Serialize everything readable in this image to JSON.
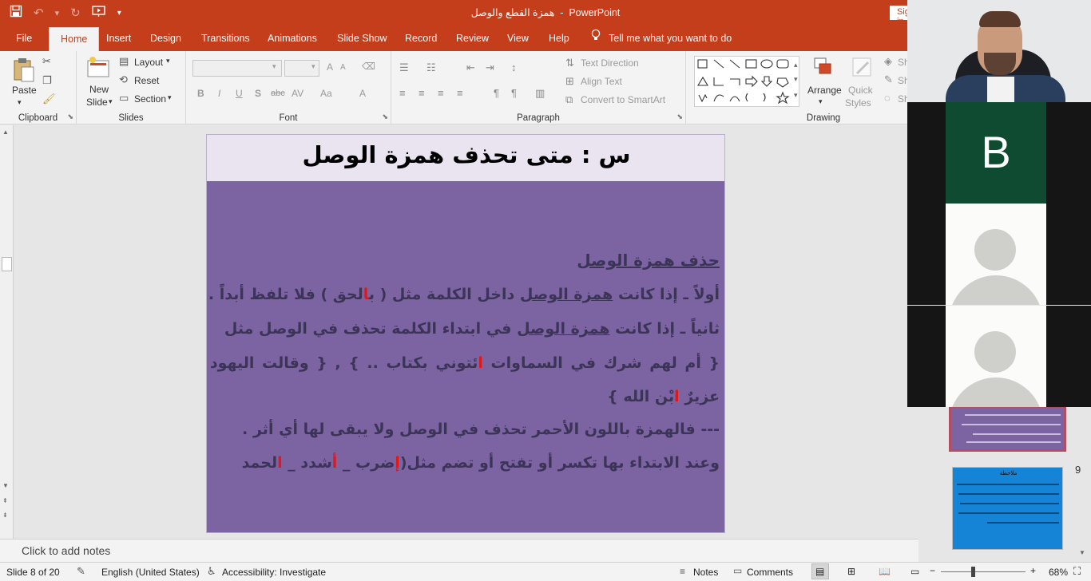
{
  "window": {
    "doc_title": "همزة القطع والوصل",
    "app_sep": "  -  ",
    "app_name": "PowerPoint",
    "signin": "Sign in"
  },
  "qat": {
    "save_icon": "save-icon",
    "undo_icon": "undo-icon",
    "redo_icon": "redo-icon",
    "present_icon": "start-from-beginning-icon",
    "more_icon": "customize-icon"
  },
  "tabs": [
    "File",
    "Home",
    "Insert",
    "Design",
    "Transitions",
    "Animations",
    "Slide Show",
    "Record",
    "Review",
    "View",
    "Help"
  ],
  "tell_me": "Tell me what you want to do",
  "ribbon": {
    "clipboard": {
      "label": "Clipboard",
      "paste": "Paste"
    },
    "slides": {
      "label": "Slides",
      "new_slide_1": "New",
      "new_slide_2": "Slide",
      "layout": "Layout",
      "reset": "Reset",
      "section": "Section"
    },
    "font": {
      "label": "Font",
      "bold": "B",
      "italic": "I",
      "underline": "U",
      "shadow": "S",
      "strike": "abc",
      "spacing": "AV",
      "case": "Aa",
      "color": "A"
    },
    "paragraph": {
      "label": "Paragraph",
      "text_direction": "Text Direction",
      "align_text": "Align Text",
      "smartart": "Convert to SmartArt"
    },
    "drawing": {
      "label": "Drawing",
      "arrange": "Arrange",
      "quick_styles_1": "Quick",
      "quick_styles_2": "Styles",
      "shape_fill": "Sh",
      "shape_outline": "Sh",
      "shape_effects": "Sh"
    }
  },
  "slide": {
    "title": "س : متى تحذف همزة الوصل",
    "heading": "حذف همزة الوصل",
    "l1_a": "أولاً ـ إذا كانت",
    "l1_b": "همزة الوصل",
    "l1_c": "داخل الكلمة مثل ( ب",
    "l1_d": "ا",
    "l1_e": "لحق ) فلا تلفظ أبداً .",
    "l2_a": "ثانياً ـ إذا كانت",
    "l2_b": "همزة الوصل",
    "l2_c": "في ابتداء الكلمة تحذف في الوصل مثل",
    "l3_a": "{ أم لهم شرك في السماوات",
    "l3_b": "ا",
    "l3_c": "ئتوني بكتاب .. } , { وقالت اليهود",
    "l4_a": "عزيرٌ",
    "l4_b": "ا",
    "l4_c": "بْن الله }",
    "l5": "--- فالهمزة باللون الأحمر تحذف في الوصل ولا يبقى لها أي أثر .",
    "l6_a": "وعند الابتداء بها تكسر أو تفتح أو تضم مثل(",
    "l6_b": "إ",
    "l6_c": "ضرب _",
    "l6_d": "أ",
    "l6_e": "شدد _",
    "l6_f": "ا",
    "l6_g": "لحمد"
  },
  "thumbnails": {
    "slide9_num": "9",
    "slide9_title": "ملاحظة"
  },
  "video": {
    "tile2_letter": "B"
  },
  "notes": {
    "placeholder": "Click to add notes"
  },
  "status": {
    "slide_info": "Slide 8 of 20",
    "language": "English (United States)",
    "accessibility": "Accessibility: Investigate",
    "notes": "Notes",
    "comments": "Comments",
    "zoom": "68%"
  },
  "colors": {
    "accent": "#c43e1c",
    "slide_bg": "#7c64a3",
    "slide_title_bg": "#e9e4f0",
    "highlight_red": "#e01818"
  }
}
